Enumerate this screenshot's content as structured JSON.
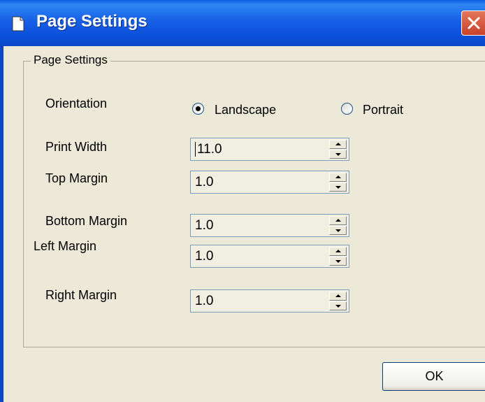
{
  "window": {
    "title": "Page Settings",
    "icon": "document-icon"
  },
  "group": {
    "label": "Page Settings"
  },
  "orientation": {
    "label": "Orientation",
    "options": [
      {
        "label": "Landscape",
        "selected": true
      },
      {
        "label": "Portrait",
        "selected": false
      }
    ]
  },
  "fields": {
    "print_width": {
      "label": "Print Width",
      "value": "11.0"
    },
    "top_margin": {
      "label": "Top Margin",
      "value": "1.0"
    },
    "bottom_margin": {
      "label": "Bottom Margin",
      "value": "1.0"
    },
    "left_margin": {
      "label": "Left Margin",
      "value": "1.0"
    },
    "right_margin": {
      "label": "Right Margin",
      "value": "1.0"
    }
  },
  "buttons": {
    "ok": "OK"
  },
  "colors": {
    "titlebar": "#0B55D8",
    "close": "#D6573A",
    "dialog_bg": "#ECE9D8"
  }
}
